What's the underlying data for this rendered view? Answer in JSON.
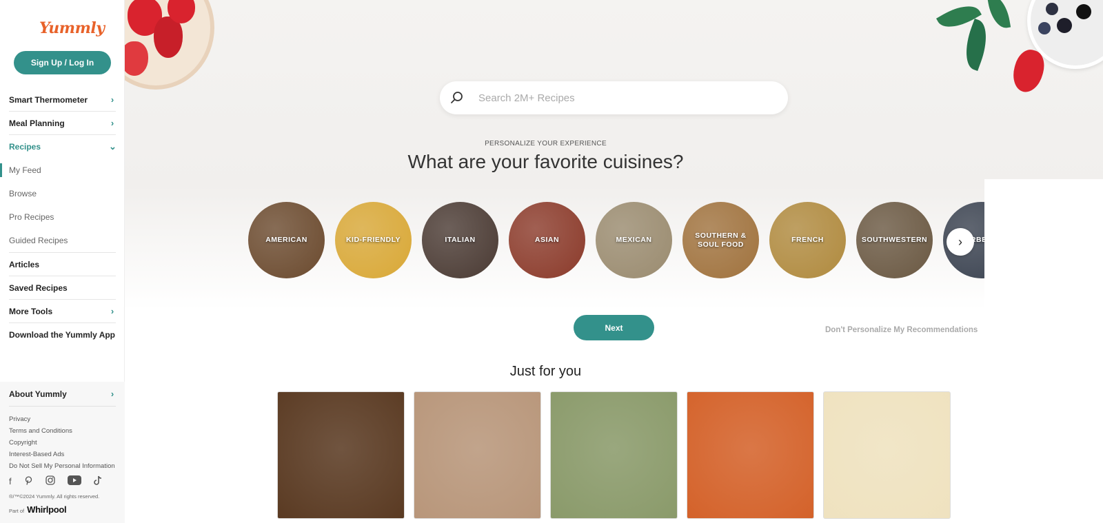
{
  "brand": {
    "logo_text": "Yummly",
    "accent": "#33918b",
    "logo_color": "#e8622a"
  },
  "sidebar": {
    "signup_label": "Sign Up / Log In",
    "items": [
      {
        "label": "Smart Thermometer",
        "icon": "chevron-right-icon"
      },
      {
        "label": "Meal Planning",
        "icon": "chevron-right-icon"
      },
      {
        "label": "Recipes",
        "icon": "chevron-down-icon"
      }
    ],
    "recipes_sub": [
      "My Feed",
      "Browse",
      "Pro Recipes",
      "Guided Recipes"
    ],
    "items_after": [
      {
        "label": "Articles"
      },
      {
        "label": "Saved Recipes"
      },
      {
        "label": "More Tools",
        "icon": "chevron-right-icon"
      },
      {
        "label": "Download the Yummly App"
      }
    ],
    "about_label": "About Yummly",
    "footer_links": [
      "Privacy",
      "Terms and Conditions",
      "Copyright",
      "Interest-Based Ads",
      "Do Not Sell My Personal Information"
    ],
    "social_icons": [
      "facebook-icon",
      "pinterest-icon",
      "instagram-icon",
      "youtube-icon",
      "tiktok-icon"
    ],
    "copyright": "®/™©2024 Yummly. All rights reserved.",
    "part_of_label": "Part of",
    "part_of_brand": "Whirlpool"
  },
  "search": {
    "placeholder": "Search 2M+ Recipes"
  },
  "personalize": {
    "eyebrow": "PERSONALIZE YOUR EXPERIENCE",
    "headline": "What are your favorite cuisines?",
    "cuisines": [
      {
        "label": "AMERICAN",
        "color": "#6b4a2e"
      },
      {
        "label": "KID-FRIENDLY",
        "color": "#d9a836"
      },
      {
        "label": "ITALIAN",
        "color": "#4a3a33"
      },
      {
        "label": "ASIAN",
        "color": "#8b3a2a"
      },
      {
        "label": "MEXICAN",
        "color": "#9a8b6f"
      },
      {
        "label": "SOUTHERN & SOUL FOOD",
        "color": "#a0723d"
      },
      {
        "label": "FRENCH",
        "color": "#b08a3e"
      },
      {
        "label": "SOUTHWESTERN",
        "color": "#6a5842"
      },
      {
        "label": "BARBECUE",
        "color": "#3a4250"
      }
    ],
    "next_label": "Next",
    "skip_label": "Don't Personalize My Recommendations"
  },
  "just_for_you": {
    "title": "Just for you",
    "cards": [
      {
        "name": "fajitas-recipe-card",
        "color": "#5a3a22"
      },
      {
        "name": "pasta-salad-recipe-card",
        "color": "#b8967a"
      },
      {
        "name": "sandwich-recipe-card",
        "color": "#8a9a6a"
      },
      {
        "name": "fruit-salad-recipe-card",
        "color": "#d4622a"
      },
      {
        "name": "scones-recipe-card",
        "color": "#efe2bf"
      }
    ]
  }
}
